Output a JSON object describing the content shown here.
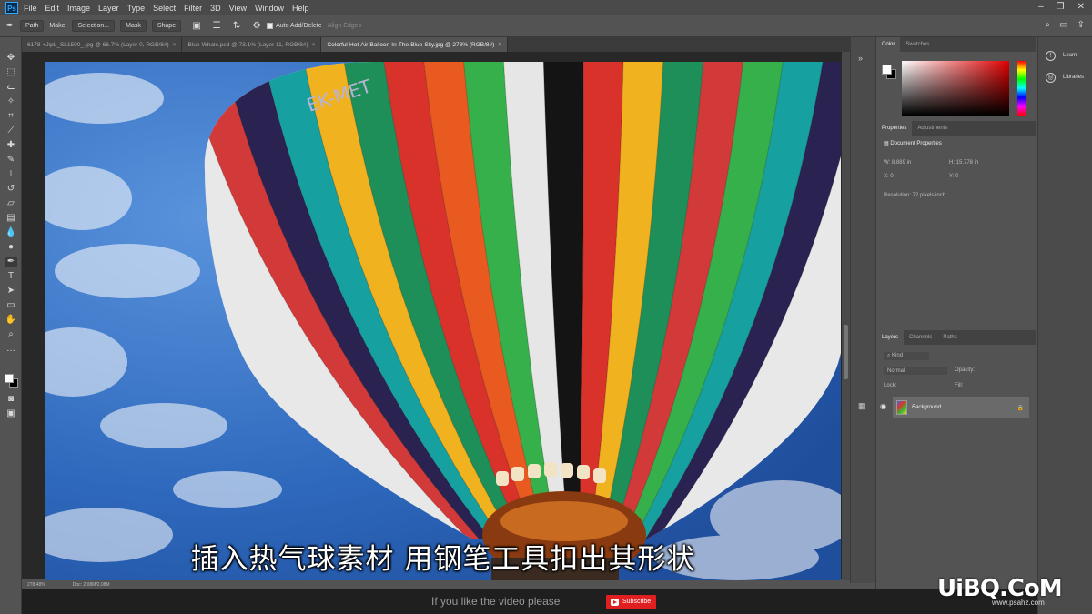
{
  "menubar": {
    "app_icon": "Ps",
    "items": [
      "File",
      "Edit",
      "Image",
      "Layer",
      "Type",
      "Select",
      "Filter",
      "3D",
      "View",
      "Window",
      "Help"
    ],
    "right_icons": [
      "search-icon",
      "workspace-icon",
      "share-icon"
    ]
  },
  "options": {
    "mode_value": "Path",
    "make_label": "Make:",
    "selection_button": "Selection...",
    "mask_button": "Mask",
    "shape_button": "Shape",
    "auto_add_delete_label": "Auto Add/Delete",
    "align_edges_label": "Align Edges"
  },
  "tabs": [
    {
      "label": "6178-+JipL_SL1500_.jpg @ 66.7% (Layer 0, RGB/8#)",
      "active": false
    },
    {
      "label": "Blue-Whale.psd @ 73.1% (Layer 11, RGB/8#)",
      "active": false
    },
    {
      "label": "Colorful-Hot-Air-Balloon-In-The-Blue-Sky.jpg @ 278% (RGB/8#)",
      "active": true
    }
  ],
  "status": {
    "zoom": "278.48%",
    "doc": "Doc: 2.08M/2.08M"
  },
  "panels": {
    "color_tab": "Color",
    "swatches_tab": "Swatches",
    "properties_tab": "Properties",
    "adjustments_tab": "Adjustments",
    "doc_props_title": "Document Properties",
    "w_label": "W:",
    "w_value": "8.889 in",
    "h_label": "H:",
    "h_value": "15.778 in",
    "x_label": "X:",
    "x_value": "0",
    "y_label": "Y:",
    "y_value": "0",
    "resolution": "Resolution: 72 pixels/inch",
    "layers_tab": "Layers",
    "channels_tab": "Channels",
    "paths_tab": "Paths",
    "kind_label": "Kind",
    "blend_mode": "Normal",
    "opacity_label": "Opacity:",
    "lock_label": "Lock:",
    "fill_label": "Fill:",
    "layer_name": "Background"
  },
  "learn": {
    "learn_label": "Learn",
    "libraries_label": "Libraries"
  },
  "subtitle": "插入热气球素材 用钢笔工具扣出其形状",
  "bottom": {
    "message": "If you like the video please",
    "subscribe": "Subscribe"
  },
  "watermark": {
    "logo": "UiBQ.CoM",
    "site": "www.psahz.com"
  },
  "balloon_text": "EK-MET",
  "colors": {
    "sky": "#2f6fc0",
    "stripes": [
      "#e6e6e6",
      "#d23a3a",
      "#2a2250",
      "#1f8f5a",
      "#f0b21e",
      "#d8322a",
      "#17a0a0",
      "#141414",
      "#e85a20",
      "#35b04a"
    ]
  }
}
